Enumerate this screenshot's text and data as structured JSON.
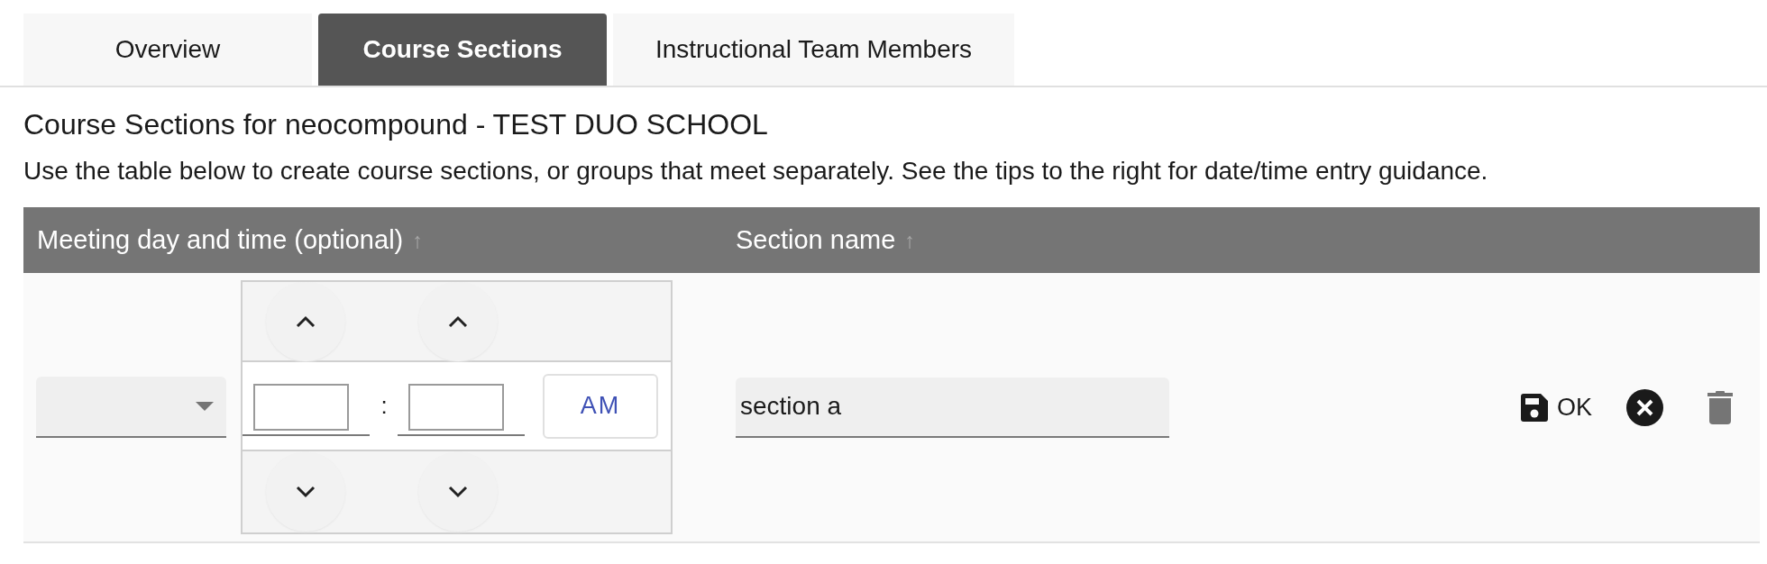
{
  "tabs": [
    {
      "label": "Overview",
      "selected": false
    },
    {
      "label": "Course Sections",
      "selected": true
    },
    {
      "label": "Instructional Team Members",
      "selected": false
    }
  ],
  "heading": "Course Sections for neocompound - TEST DUO SCHOOL",
  "description": "Use the table below to create course sections, or groups that meet separately. See the tips to the right for date/time entry guidance.",
  "table": {
    "columns": [
      {
        "label": "Meeting day and time (optional)",
        "sort_mark": "↑"
      },
      {
        "label": "Section name",
        "sort_mark": "↑"
      }
    ],
    "rows": [
      {
        "time": {
          "separator": ":",
          "meridiem": "AM"
        },
        "section_name": "section a",
        "save_label": "OK"
      }
    ]
  }
}
